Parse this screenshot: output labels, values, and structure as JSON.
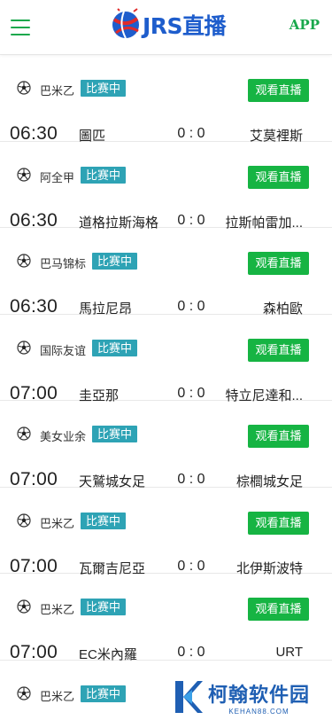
{
  "header": {
    "logo_text": "JRS直播",
    "app_label": "APP"
  },
  "matches": [
    {
      "league": "巴米乙",
      "status": "比赛中",
      "watch_label": "观看直播",
      "time": "06:30",
      "home": "圖匹",
      "score": "0 : 0",
      "away": "艾莫裡斯"
    },
    {
      "league": "阿全甲",
      "status": "比赛中",
      "watch_label": "观看直播",
      "time": "06:30",
      "home": "道格拉斯海格",
      "score": "0 : 0",
      "away": "拉斯帕雷加..."
    },
    {
      "league": "巴马锦标",
      "status": "比赛中",
      "watch_label": "观看直播",
      "time": "06:30",
      "home": "馬拉尼昂",
      "score": "0 : 0",
      "away": "森柏歐"
    },
    {
      "league": "国际友谊",
      "status": "比赛中",
      "watch_label": "观看直播",
      "time": "07:00",
      "home": "圭亞那",
      "score": "0 : 0",
      "away": "特立尼達和..."
    },
    {
      "league": "美女业余",
      "status": "比赛中",
      "watch_label": "观看直播",
      "time": "07:00",
      "home": "天鷲城女足",
      "score": "0 : 0",
      "away": "棕櫚城女足"
    },
    {
      "league": "巴米乙",
      "status": "比赛中",
      "watch_label": "观看直播",
      "time": "07:00",
      "home": "瓦爾吉尼亞",
      "score": "0 : 0",
      "away": "北伊斯波特"
    },
    {
      "league": "巴米乙",
      "status": "比赛中",
      "watch_label": "观看直播",
      "time": "07:00",
      "home": "EC米內羅",
      "score": "0 : 0",
      "away": "URT"
    },
    {
      "league": "巴米乙",
      "status": "比赛中"
    }
  ],
  "watermark": {
    "name": "柯翰软件园",
    "domain": "KEHAN88.COM"
  },
  "colors": {
    "accent_green": "#16b443",
    "badge_teal": "#2ea3b5",
    "logo_blue": "#1e5dcc"
  }
}
